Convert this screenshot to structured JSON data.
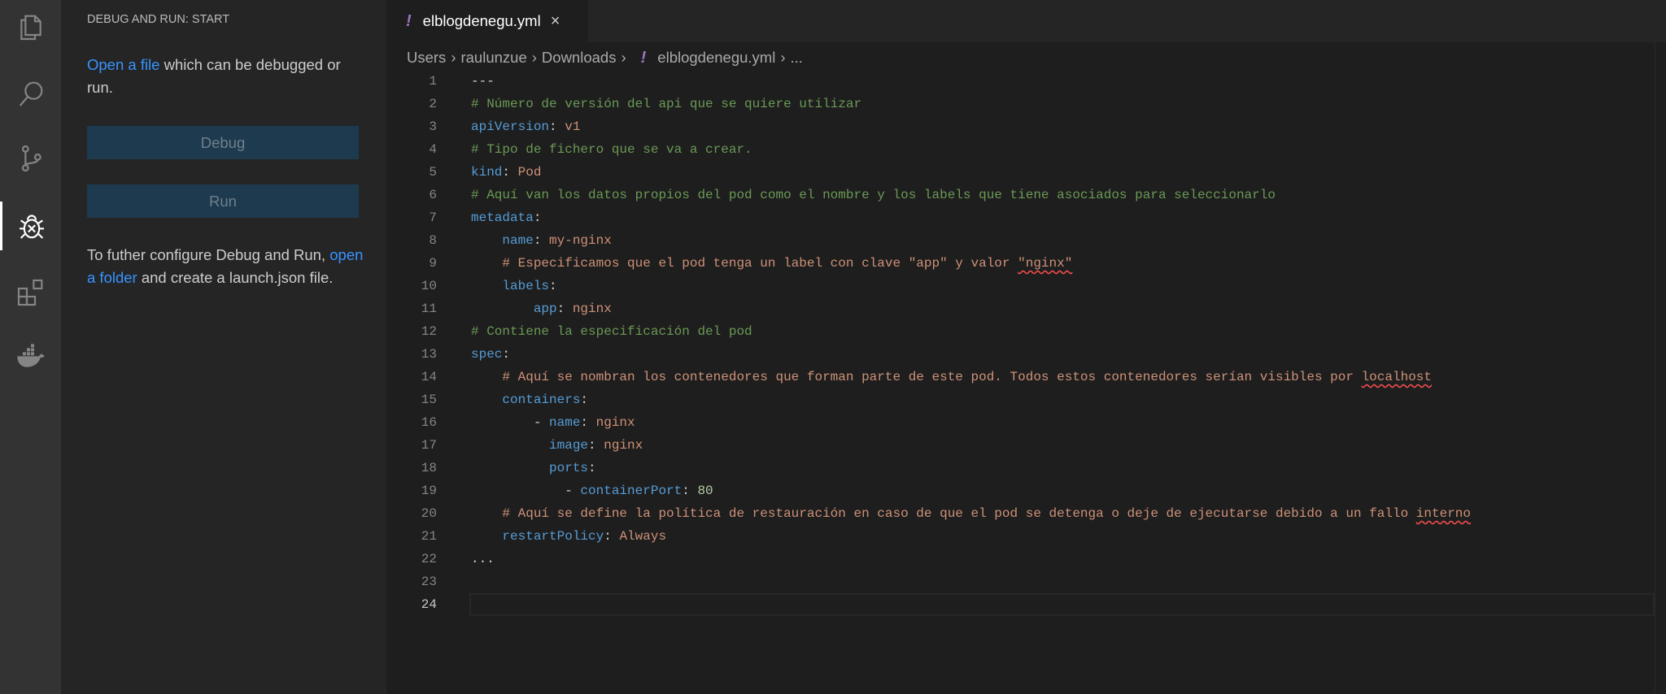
{
  "activity_bar": {
    "items": [
      {
        "icon": "files-icon"
      },
      {
        "icon": "search-icon"
      },
      {
        "icon": "source-control-icon"
      },
      {
        "icon": "debug-icon",
        "active": true
      },
      {
        "icon": "extensions-icon"
      },
      {
        "icon": "docker-icon"
      }
    ]
  },
  "sidebar": {
    "title": "DEBUG AND RUN: START",
    "open_file_link": "Open a file",
    "open_file_rest": " which can be debugged or run.",
    "debug_button": "Debug",
    "run_button": "Run",
    "configure_text": "To futher configure Debug and Run,",
    "open_folder_link": "open a folder",
    "configure_rest": " and create a launch.json file."
  },
  "tab": {
    "icon": "!",
    "label": "elblogdenegu.yml",
    "close": "×"
  },
  "breadcrumb": {
    "items": [
      "Users",
      "raulunzue",
      "Downloads"
    ],
    "file_icon": "!",
    "file": "elblogdenegu.yml",
    "more": "...",
    "separator": "›"
  },
  "editor": {
    "current_line": 24,
    "lines": [
      [
        [
          "p",
          "---"
        ]
      ],
      [
        [
          "c",
          "# Número de versión del api que se quiere utilizar"
        ]
      ],
      [
        [
          "k",
          "apiVersion"
        ],
        [
          "p",
          ": "
        ],
        [
          "s",
          "v1"
        ]
      ],
      [
        [
          "c",
          "# Tipo de fichero que se va a crear."
        ]
      ],
      [
        [
          "k",
          "kind"
        ],
        [
          "p",
          ": "
        ],
        [
          "s",
          "Pod"
        ]
      ],
      [
        [
          "c",
          "# Aquí van los datos propios del pod como el nombre y los labels que tiene asociados para seleccionarlo"
        ]
      ],
      [
        [
          "k",
          "metadata"
        ],
        [
          "p",
          ":"
        ]
      ],
      [
        [
          "p",
          "    "
        ],
        [
          "k",
          "name"
        ],
        [
          "p",
          ": "
        ],
        [
          "s",
          "my-nginx"
        ]
      ],
      [
        [
          "p",
          "    "
        ],
        [
          "s",
          "# Especificamos que el pod tenga un label con clave \"app\" y valor "
        ],
        [
          "s sq",
          "\"nginx\""
        ]
      ],
      [
        [
          "p",
          "    "
        ],
        [
          "k",
          "labels"
        ],
        [
          "p",
          ":"
        ]
      ],
      [
        [
          "p",
          "        "
        ],
        [
          "k",
          "app"
        ],
        [
          "p",
          ": "
        ],
        [
          "s",
          "nginx"
        ]
      ],
      [
        [
          "c",
          "# Contiene la especificación del pod"
        ]
      ],
      [
        [
          "k",
          "spec"
        ],
        [
          "p",
          ":"
        ]
      ],
      [
        [
          "p",
          "    "
        ],
        [
          "s",
          "# Aquí se nombran los contenedores que forman parte de este pod. Todos estos contenedores serían visibles por "
        ],
        [
          "s sq",
          "localhost"
        ]
      ],
      [
        [
          "p",
          "    "
        ],
        [
          "k",
          "containers"
        ],
        [
          "p",
          ":"
        ]
      ],
      [
        [
          "p",
          "        - "
        ],
        [
          "k",
          "name"
        ],
        [
          "p",
          ": "
        ],
        [
          "s",
          "nginx"
        ]
      ],
      [
        [
          "p",
          "          "
        ],
        [
          "k",
          "image"
        ],
        [
          "p",
          ": "
        ],
        [
          "s",
          "nginx"
        ]
      ],
      [
        [
          "p",
          "          "
        ],
        [
          "k",
          "ports"
        ],
        [
          "p",
          ":"
        ]
      ],
      [
        [
          "p",
          "            - "
        ],
        [
          "k",
          "containerPort"
        ],
        [
          "p",
          ": "
        ],
        [
          "n",
          "80"
        ]
      ],
      [
        [
          "p",
          "    "
        ],
        [
          "s",
          "# Aquí se define la política de restauración en caso de que el pod se detenga o deje de ejecutarse debido a un fallo "
        ],
        [
          "s sq",
          "interno"
        ]
      ],
      [
        [
          "p",
          "    "
        ],
        [
          "k",
          "restartPolicy"
        ],
        [
          "p",
          ": "
        ],
        [
          "s",
          "Always"
        ]
      ],
      [
        [
          "p",
          "..."
        ]
      ],
      [],
      []
    ]
  }
}
